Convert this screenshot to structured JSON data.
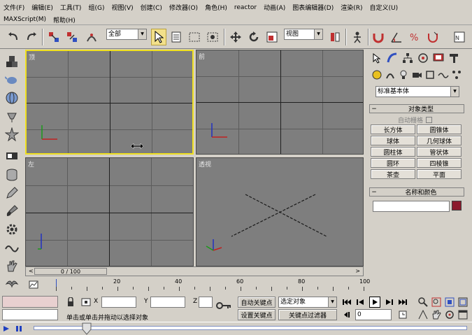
{
  "menubar": {
    "items": [
      "文件(F)",
      "编辑(E)",
      "工具(T)",
      "组(G)",
      "视图(V)",
      "创建(C)",
      "修改器(O)",
      "角色(H)",
      "reactor",
      "动画(A)",
      "图表编辑器(D)",
      "渲染(R)",
      "自定义(U)"
    ]
  },
  "maxscript": {
    "label": "MAXScript(M)",
    "help": "帮助(H)"
  },
  "toolbar": {
    "selection_filter": "全部",
    "ref_coord": "视图"
  },
  "viewports": {
    "top": {
      "label": "顶"
    },
    "front": {
      "label": "前"
    },
    "left": {
      "label": "左"
    },
    "perspective": {
      "label": "透视"
    }
  },
  "cmdpanel": {
    "category": "标准基本体",
    "object_type": {
      "title": "对象类型",
      "autogrid": "自动栅格",
      "buttons": [
        "长方体",
        "圆锥体",
        "球体",
        "几何球体",
        "圆柱体",
        "管状体",
        "圆环",
        "四棱锥",
        "茶壶",
        "平面"
      ]
    },
    "name_color": {
      "title": "名称和颜色"
    },
    "swatch_color": "#8b1a2c"
  },
  "timeline": {
    "frame_display": "0 / 100",
    "current_frame": 0,
    "total_frames": 100,
    "ticks": [
      "20",
      "40",
      "60",
      "80",
      "100"
    ]
  },
  "status": {
    "prompt": "单击或单击并拖动以选择对象",
    "x_label": "X",
    "y_label": "Y",
    "z_label": "Z",
    "autokey": "自动关键点",
    "setkey": "设置关键点",
    "selected_combo": "选定对象",
    "key_filters": "关键点过滤器",
    "frame_input": "0"
  }
}
